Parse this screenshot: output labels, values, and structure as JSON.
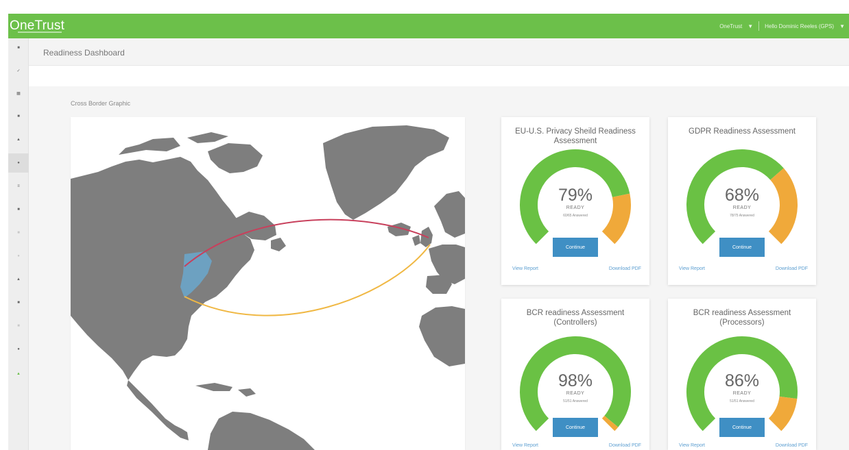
{
  "app": {
    "brand": "OneTrust",
    "brand_sub": "",
    "account": "OneTrust",
    "user": "Hello Dominic Reeles (GPS)"
  },
  "page": {
    "title": "Readiness Dashboard"
  },
  "map": {
    "title": "Cross Border Graphic"
  },
  "colors": {
    "brand": "#6cc04a",
    "gauge_green": "#6ac144",
    "gauge_orange": "#f0a93a",
    "button": "#3f8fc4",
    "link": "#5d9fd1",
    "land": "#7e7e7e",
    "flow_red": "#c8405c",
    "flow_yellow": "#f0b844",
    "flow_blue": "#6aa7cc"
  },
  "sidebar": {
    "items": [
      {
        "icon": "dashboard-icon"
      },
      {
        "icon": "check-icon"
      },
      {
        "icon": "grid-icon"
      },
      {
        "icon": "inventory-icon"
      },
      {
        "icon": "assessment-icon"
      },
      {
        "icon": "settings-icon"
      },
      {
        "icon": "list-icon"
      },
      {
        "icon": "vendor-icon"
      },
      {
        "icon": "policy-icon"
      },
      {
        "icon": "cookie-icon"
      },
      {
        "icon": "incident-icon"
      },
      {
        "icon": "people-icon"
      },
      {
        "icon": "report-icon"
      },
      {
        "icon": "help-icon"
      },
      {
        "icon": "onetrust-icon"
      }
    ]
  },
  "assessments": [
    {
      "title": "EU-U.S. Privacy Sheild Readiness Assessment",
      "percent": "79%",
      "percent_value": 79,
      "ready": "READY",
      "assessed": "60/65 Answered",
      "button": "Continue",
      "view_report": "View Report",
      "download": "Download PDF"
    },
    {
      "title": "GDPR Readiness Assessment",
      "percent": "68%",
      "percent_value": 68,
      "ready": "READY",
      "assessed": "78/75 Answered",
      "button": "Continue",
      "view_report": "View Report",
      "download": "Download PDF"
    },
    {
      "title": "BCR readiness Assessment (Controllers)",
      "percent": "98%",
      "percent_value": 98,
      "ready": "READY",
      "assessed": "51/51 Answered",
      "button": "Continue",
      "view_report": "View Report",
      "download": "Download PDF"
    },
    {
      "title": "BCR readiness Assessment (Processors)",
      "percent": "86%",
      "percent_value": 86,
      "ready": "READY",
      "assessed": "51/51 Answered",
      "button": "Continue",
      "view_report": "View Report",
      "download": "Download PDF"
    }
  ]
}
